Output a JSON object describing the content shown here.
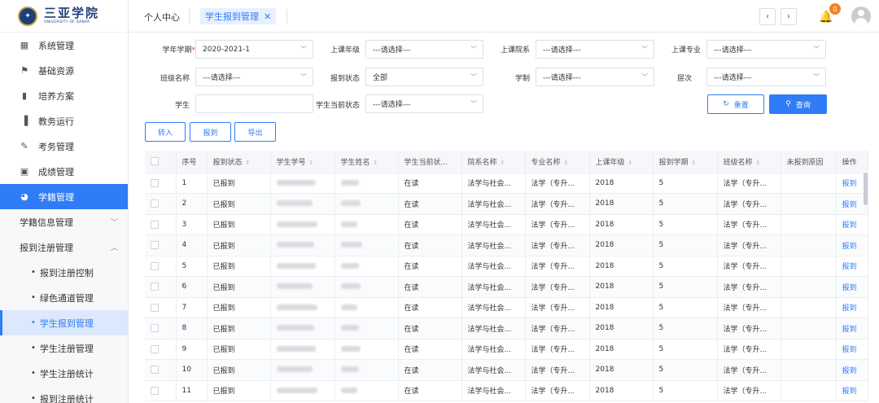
{
  "logo": {
    "cn": "三亚学院",
    "en": "UNIVERSITY OF SANYA"
  },
  "sidebar": {
    "items": [
      {
        "label": "系统管理",
        "icon": "grid-icon"
      },
      {
        "label": "基础资源",
        "icon": "flag-icon"
      },
      {
        "label": "培养方案",
        "icon": "book-icon"
      },
      {
        "label": "教务运行",
        "icon": "ledger-icon"
      },
      {
        "label": "考务管理",
        "icon": "pen-icon"
      },
      {
        "label": "成绩管理",
        "icon": "briefcase-icon"
      },
      {
        "label": "学籍管理",
        "icon": "chart-pie-icon"
      }
    ],
    "groups": [
      {
        "label": "学籍信息管理",
        "chevron": "chevron-down-icon"
      },
      {
        "label": "报到注册管理",
        "chevron": "chevron-up-icon"
      }
    ],
    "leaves": [
      "报到注册控制",
      "绿色通道管理",
      "学生报到管理",
      "学生注册管理",
      "学生注册统计",
      "报到注册统计"
    ]
  },
  "header": {
    "home_tab": "个人中心",
    "active_tab": "学生报到管理",
    "notification_count": "0"
  },
  "filters": {
    "term_label": "学年学期",
    "term_value": "2020-2021-1",
    "grade_label": "上课年级",
    "college_label": "上课院系",
    "major_label": "上课专业",
    "class_label": "班级名称",
    "status_label": "报到状态",
    "status_value": "全部",
    "system_label": "学制",
    "level_label": "层次",
    "student_label": "学生",
    "current_label": "学生当前状态",
    "placeholder": "---请选择---"
  },
  "actions": {
    "reset": "重置",
    "query": "查询",
    "transfer_in": "转入",
    "register": "报到",
    "export": "导出"
  },
  "table": {
    "columns": [
      "序号",
      "报到状态",
      "学生学号",
      "学生姓名",
      "学生当前状...",
      "院系名称",
      "专业名称",
      "上课年级",
      "报到学期",
      "班级名称",
      "未报到原因",
      "操作"
    ],
    "rows": [
      {
        "no": "1",
        "status": "已报到",
        "current": "在读",
        "college": "法学与社会...",
        "major": "法学（专升...",
        "grade": "2018",
        "term": "5",
        "class": "法学（专升...",
        "op": "报到"
      },
      {
        "no": "2",
        "status": "已报到",
        "current": "在读",
        "college": "法学与社会...",
        "major": "法学（专升...",
        "grade": "2018",
        "term": "5",
        "class": "法学（专升...",
        "op": "报到"
      },
      {
        "no": "3",
        "status": "已报到",
        "current": "在读",
        "college": "法学与社会...",
        "major": "法学（专升...",
        "grade": "2018",
        "term": "5",
        "class": "法学（专升...",
        "op": "报到"
      },
      {
        "no": "4",
        "status": "已报到",
        "current": "在读",
        "college": "法学与社会...",
        "major": "法学（专升...",
        "grade": "2018",
        "term": "5",
        "class": "法学（专升...",
        "op": "报到"
      },
      {
        "no": "5",
        "status": "已报到",
        "current": "在读",
        "college": "法学与社会...",
        "major": "法学（专升...",
        "grade": "2018",
        "term": "5",
        "class": "法学（专升...",
        "op": "报到"
      },
      {
        "no": "6",
        "status": "已报到",
        "current": "在读",
        "college": "法学与社会...",
        "major": "法学（专升...",
        "grade": "2018",
        "term": "5",
        "class": "法学（专升...",
        "op": "报到"
      },
      {
        "no": "7",
        "status": "已报到",
        "current": "在读",
        "college": "法学与社会...",
        "major": "法学（专升...",
        "grade": "2018",
        "term": "5",
        "class": "法学（专升...",
        "op": "报到"
      },
      {
        "no": "8",
        "status": "已报到",
        "current": "在读",
        "college": "法学与社会...",
        "major": "法学（专升...",
        "grade": "2018",
        "term": "5",
        "class": "法学（专升...",
        "op": "报到"
      },
      {
        "no": "9",
        "status": "已报到",
        "current": "在读",
        "college": "法学与社会...",
        "major": "法学（专升...",
        "grade": "2018",
        "term": "5",
        "class": "法学（专升...",
        "op": "报到"
      },
      {
        "no": "10",
        "status": "已报到",
        "current": "在读",
        "college": "法学与社会...",
        "major": "法学（专升...",
        "grade": "2018",
        "term": "5",
        "class": "法学（专升...",
        "op": "报到"
      },
      {
        "no": "11",
        "status": "已报到",
        "current": "在读",
        "college": "法学与社会...",
        "major": "法学（专升...",
        "grade": "2018",
        "term": "5",
        "class": "法学（专升...",
        "op": "报到"
      }
    ]
  },
  "colors": {
    "primary": "#2f7cf6",
    "badge": "#f5821f",
    "brand": "#1d3f7a"
  }
}
